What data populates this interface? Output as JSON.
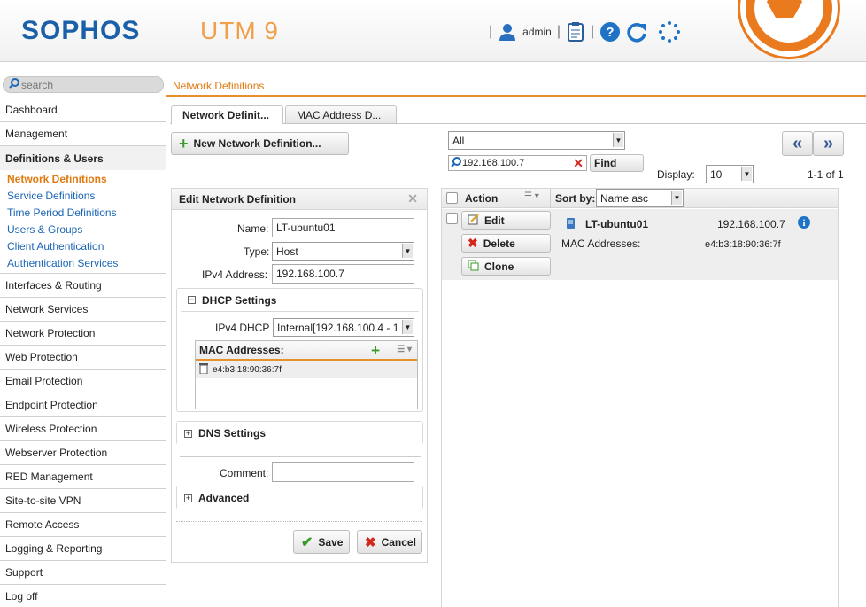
{
  "header": {
    "logo": "SOPHOS",
    "product": "UTM 9",
    "user": "admin"
  },
  "search": {
    "placeholder": "search"
  },
  "breadcrumb": "Network Definitions",
  "sidebar": {
    "items": [
      {
        "label": "Dashboard"
      },
      {
        "label": "Management"
      },
      {
        "label": "Definitions & Users"
      },
      {
        "label": "Interfaces & Routing"
      },
      {
        "label": "Network Services"
      },
      {
        "label": "Network Protection"
      },
      {
        "label": "Web Protection"
      },
      {
        "label": "Email Protection"
      },
      {
        "label": "Endpoint Protection"
      },
      {
        "label": "Wireless Protection"
      },
      {
        "label": "Webserver Protection"
      },
      {
        "label": "RED Management"
      },
      {
        "label": "Site-to-site VPN"
      },
      {
        "label": "Remote Access"
      },
      {
        "label": "Logging & Reporting"
      },
      {
        "label": "Support"
      },
      {
        "label": "Log off"
      }
    ],
    "subitems": [
      {
        "label": "Network Definitions"
      },
      {
        "label": "Service Definitions"
      },
      {
        "label": "Time Period Definitions"
      },
      {
        "label": "Users & Groups"
      },
      {
        "label": "Client Authentication"
      },
      {
        "label": "Authentication Services"
      }
    ]
  },
  "tabs": [
    {
      "label": "Network Definit..."
    },
    {
      "label": "MAC Address D..."
    }
  ],
  "new_button": "New Network Definition...",
  "filter": {
    "type_value": "All",
    "search_value": "192.168.100.7",
    "find_label": "Find",
    "display_label": "Display:",
    "display_value": "10",
    "page_info": "1-1 of 1",
    "prev_label": "«",
    "next_label": "»"
  },
  "edit": {
    "title": "Edit Network Definition",
    "name_label": "Name:",
    "name_value": "LT-ubuntu01",
    "type_label": "Type:",
    "type_value": "Host",
    "ipv4_label": "IPv4 Address:",
    "ipv4_value": "192.168.100.7",
    "dhcp_title": "DHCP Settings",
    "ipv4dhcp_label": "IPv4 DHCP",
    "ipv4dhcp_value": "Internal[192.168.100.4 - 1",
    "mac_title": "MAC Addresses:",
    "mac_entry": "e4:b3:18:90:36:7f",
    "dns_title": "DNS Settings",
    "comment_label": "Comment:",
    "comment_value": "",
    "advanced_title": "Advanced",
    "save_label": "Save",
    "cancel_label": "Cancel"
  },
  "list": {
    "action_label": "Action",
    "sortby_label": "Sort by:",
    "sort_value": "Name asc",
    "edit_label": "Edit",
    "delete_label": "Delete",
    "clone_label": "Clone",
    "entry_name": "LT-ubuntu01",
    "entry_ip": "192.168.100.7",
    "entry_mac_label": "MAC Addresses:",
    "entry_mac_value": "e4:b3:18:90:36:7f"
  },
  "colors": {
    "brand_blue": "#1a5fa8",
    "accent_orange": "#e07a10",
    "link_blue": "#1c66b6"
  }
}
